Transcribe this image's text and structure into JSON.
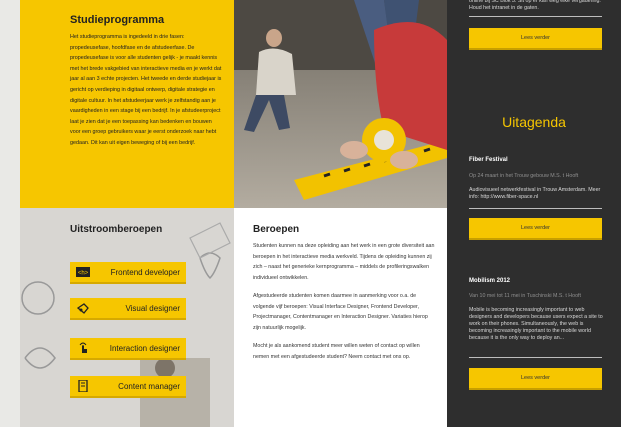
{
  "studie": {
    "title": "Studieprogramma",
    "body": "Het studieprogramma is ingedeeld in drie fasen: propedeusefase, hoofdfase en de afstudeerfase. De propedeusefase is voor alle studenten gelijk - je maakt kennis met het brede vakgebied van interactieve media en je werkt dat jaar al aan 3 echte projecten. Het tweede en derde studiejaar is gericht op verdieping in digitaal ontwerp, digitale strategie en digitale cultuur. In het afstudeerjaar werk je zelfstandig aan je vaardigheden in een stage bij een bedrijf. In je afstudeerproject laat je zien dat je een toepassing kan bedenken en bouwen voor een groep gebruikers waar je eerst onderzoek naar hebt gedaan. Dit kan uit eigen beweging of bij een bedrijf."
  },
  "uitstroom": {
    "title": "Uitstroomberoepen",
    "buttons": [
      {
        "label": "Frontend developer",
        "icon": "html-tag-icon"
      },
      {
        "label": "Visual designer",
        "icon": "hand-pointer-icon"
      },
      {
        "label": "Interaction designer",
        "icon": "touch-gesture-icon"
      },
      {
        "label": "Content manager",
        "icon": "document-icon"
      }
    ]
  },
  "beroepen": {
    "title": "Beroepen",
    "paragraphs": [
      "Studenten kunnen na deze opleiding aan het werk in een grote diversiteit aan beroepen in het interactieve media werkveld. Tijdens de opleiding kunnen zij zich – naast het generieke kernprogramma – middels de profileringswalken individueel ontwikkelen.",
      "Afgestudeerde studenten komen daarmee in aanmerking voor o.a. de volgende vijf beroepen: Visual Interface Designer, Frontend Developer, Projectmanager, Contentmanager en Interaction Designer. Variaties hierop zijn natuurlijk mogelijk.",
      "Mocht je als aankomend student meer willen weten of contact op willen nemen met een afgestudeerde student? Neem contact met ons op."
    ]
  },
  "side": {
    "top_text": "online bij SC Blok 3. Sit op er kan weg elke vergadering. Houd het intranet in de gaten.",
    "lees_verder": "Lees verder",
    "uitagenda": "Uitagenda",
    "events": [
      {
        "title": "Fiber Festival",
        "date": "Op 24 maart in het Trouw gebouw M.S. t Hooft",
        "description": "Audiovisueel netwerkfestival in Trouw Amsterdam. Meer info: http://www.fiber-space.nl"
      },
      {
        "title": "Mobilism 2012",
        "date": "Van 10 mei tot 11 mei in Tuschinski M.S. t Hooft",
        "description": "Mobile is becoming increasingly important to web designers and developers because users expect a site to work on their phones. Simultaneously, the web is becoming increasingly important to the mobile world because it is the only way to deploy an..."
      }
    ]
  },
  "colors": {
    "accent": "#f6c600",
    "dark": "#2e2e2e"
  }
}
